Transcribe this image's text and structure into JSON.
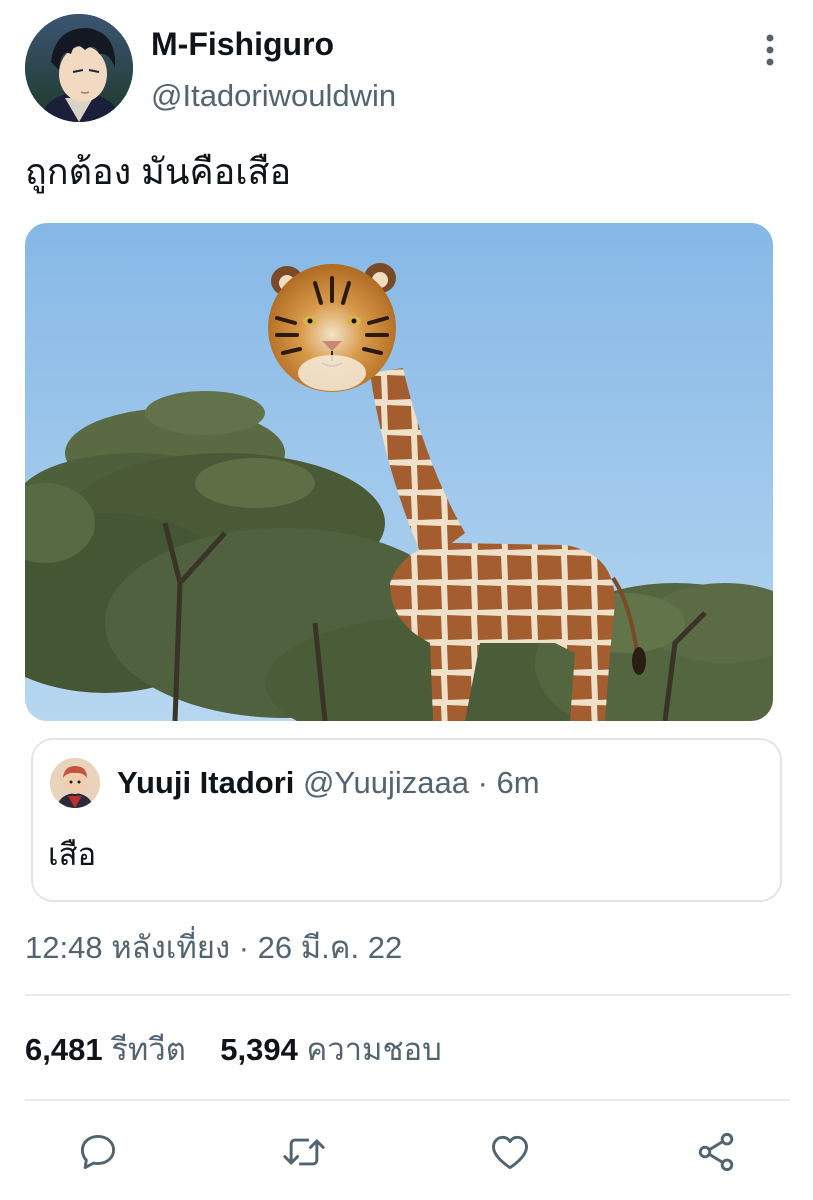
{
  "tweet": {
    "display_name": "M-Fishiguro",
    "handle": "@Itadoriwouldwin",
    "text": "ถูกต้อง มันคือเสือ",
    "timestamp": "12:48 หลังเที่ยง · 26 มี.ค. 22"
  },
  "quoted_tweet": {
    "display_name": "Yuuji Itadori",
    "handle": "@Yuujizaaa",
    "separator": "·",
    "time": "6m",
    "text": "เสือ"
  },
  "stats": {
    "retweets_count": "6,481",
    "retweets_label": "รีทวีต",
    "likes_count": "5,394",
    "likes_label": "ความชอบ"
  },
  "icons": {
    "more": "more-vertical-icon",
    "reply": "reply-icon",
    "retweet": "retweet-icon",
    "like": "heart-icon",
    "share": "share-icon"
  },
  "colors": {
    "text_primary": "#0f1419",
    "text_secondary": "#536471",
    "icon": "#536471",
    "border": "#e1e5e9",
    "sky": "#a9cfee"
  }
}
